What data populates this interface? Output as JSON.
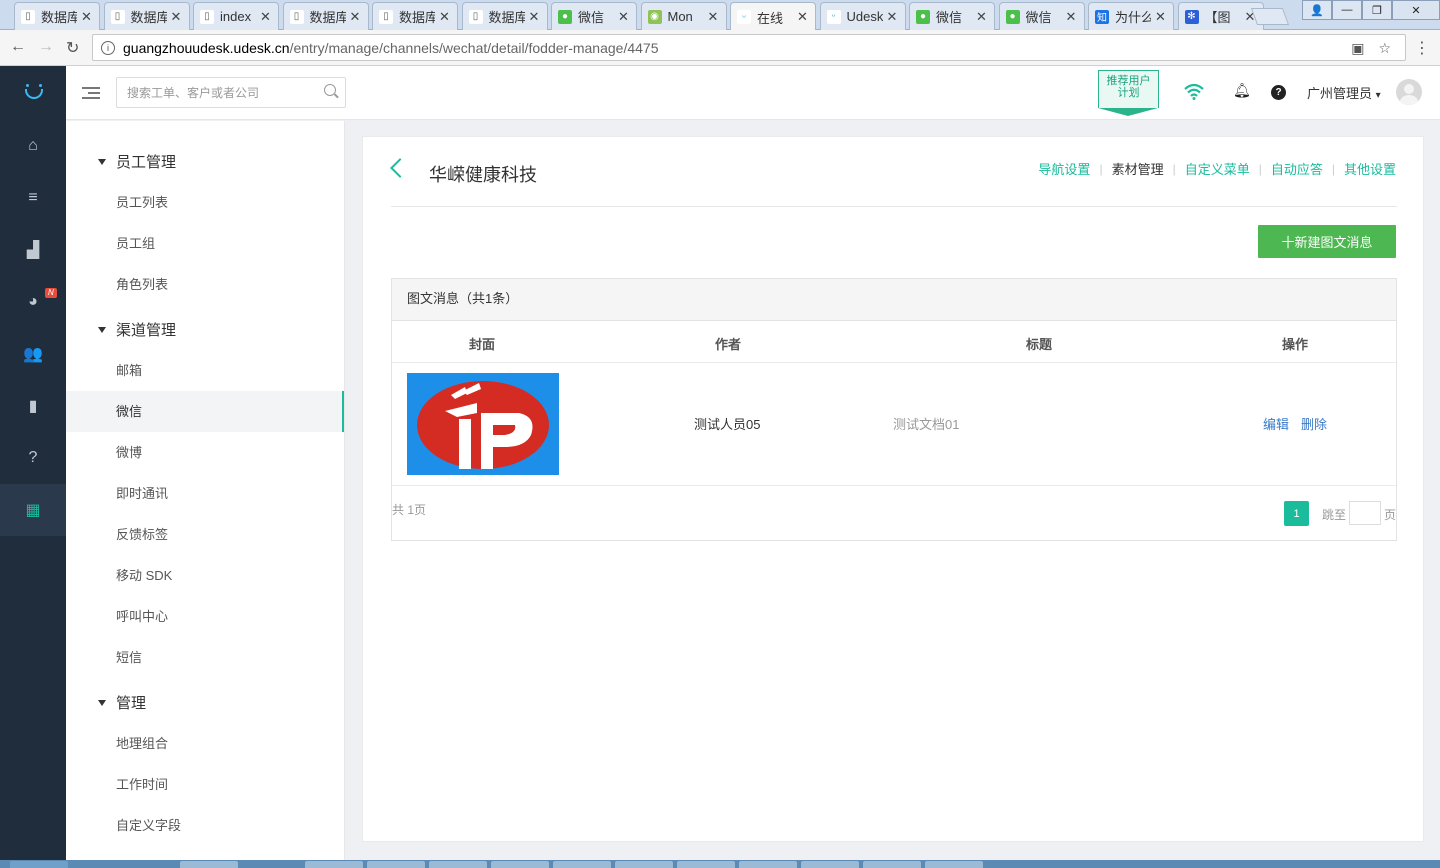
{
  "browser": {
    "tabs": [
      {
        "title": "数据库",
        "icon": "page-icon"
      },
      {
        "title": "数据库",
        "icon": "page-icon"
      },
      {
        "title": "index",
        "icon": "page-icon"
      },
      {
        "title": "数据库",
        "icon": "page-icon"
      },
      {
        "title": "数据库",
        "icon": "page-icon"
      },
      {
        "title": "数据库",
        "icon": "page-icon"
      },
      {
        "title": "微信",
        "icon": "wechat-icon"
      },
      {
        "title": "Mon",
        "icon": "monitor-icon"
      },
      {
        "title": "在线",
        "icon": "udesk-icon",
        "active": true
      },
      {
        "title": "Udesk",
        "icon": "udesk-icon"
      },
      {
        "title": "微信",
        "icon": "wechat-icon"
      },
      {
        "title": "微信",
        "icon": "wechat-icon"
      },
      {
        "title": "为什么",
        "icon": "zhihu-icon"
      },
      {
        "title": "【图",
        "icon": "baidu-icon"
      }
    ],
    "url_host": "guangzhouudesk.udesk.cn",
    "url_path": "/entry/manage/channels/wechat/detail/fodder-manage/4475"
  },
  "header": {
    "search_placeholder": "搜索工单、客户或者公司",
    "promo_line1": "推荐用户",
    "promo_line2": "计划",
    "user_name": "广州管理员",
    "user_caret": "▾"
  },
  "darknav": {
    "items": [
      {
        "icon": "home-icon",
        "glyph": "⌂"
      },
      {
        "icon": "ticket-list-icon",
        "glyph": "≡"
      },
      {
        "icon": "report-bar-icon",
        "glyph": "▟"
      },
      {
        "icon": "pie-chart-icon",
        "glyph": "◕",
        "badge": "N"
      },
      {
        "icon": "customers-icon",
        "glyph": "👥"
      },
      {
        "icon": "knowledge-book-icon",
        "glyph": "▮"
      },
      {
        "icon": "help-circle-icon",
        "glyph": "?"
      },
      {
        "icon": "settings-grid-icon",
        "glyph": "▦",
        "active": true
      }
    ]
  },
  "sidebar": {
    "groups": [
      {
        "label": "员工管理",
        "items": [
          "员工列表",
          "员工组",
          "角色列表"
        ]
      },
      {
        "label": "渠道管理",
        "items": [
          "邮箱",
          "微信",
          "微博",
          "即时通讯",
          "反馈标签",
          "移动 SDK",
          "呼叫中心",
          "短信"
        ]
      },
      {
        "label": "管理",
        "items": [
          "地理组合",
          "工作时间",
          "自定义字段"
        ]
      }
    ],
    "active_item": "微信"
  },
  "main": {
    "title": "华嵘健康科技",
    "tabs": [
      "导航设置",
      "素材管理",
      "自定义菜单",
      "自动应答",
      "其他设置"
    ],
    "current_tab": "素材管理",
    "new_button": "十新建图文消息",
    "table_caption": "图文消息（共1条）",
    "columns": [
      "封面",
      "作者",
      "标题",
      "操作"
    ],
    "rows": [
      {
        "author": "测试人员05",
        "title": "测试文档01",
        "actions": [
          "编辑",
          "删除"
        ]
      }
    ],
    "pagination": {
      "total_text": "共 1页",
      "current_page": "1",
      "jump_label": "跳至",
      "page_suffix": "页"
    }
  },
  "colors": {
    "accent": "#1abc9c",
    "primary_button": "#4db851",
    "link": "#3a7ac8",
    "dark_sidebar": "#1f2d3d"
  }
}
